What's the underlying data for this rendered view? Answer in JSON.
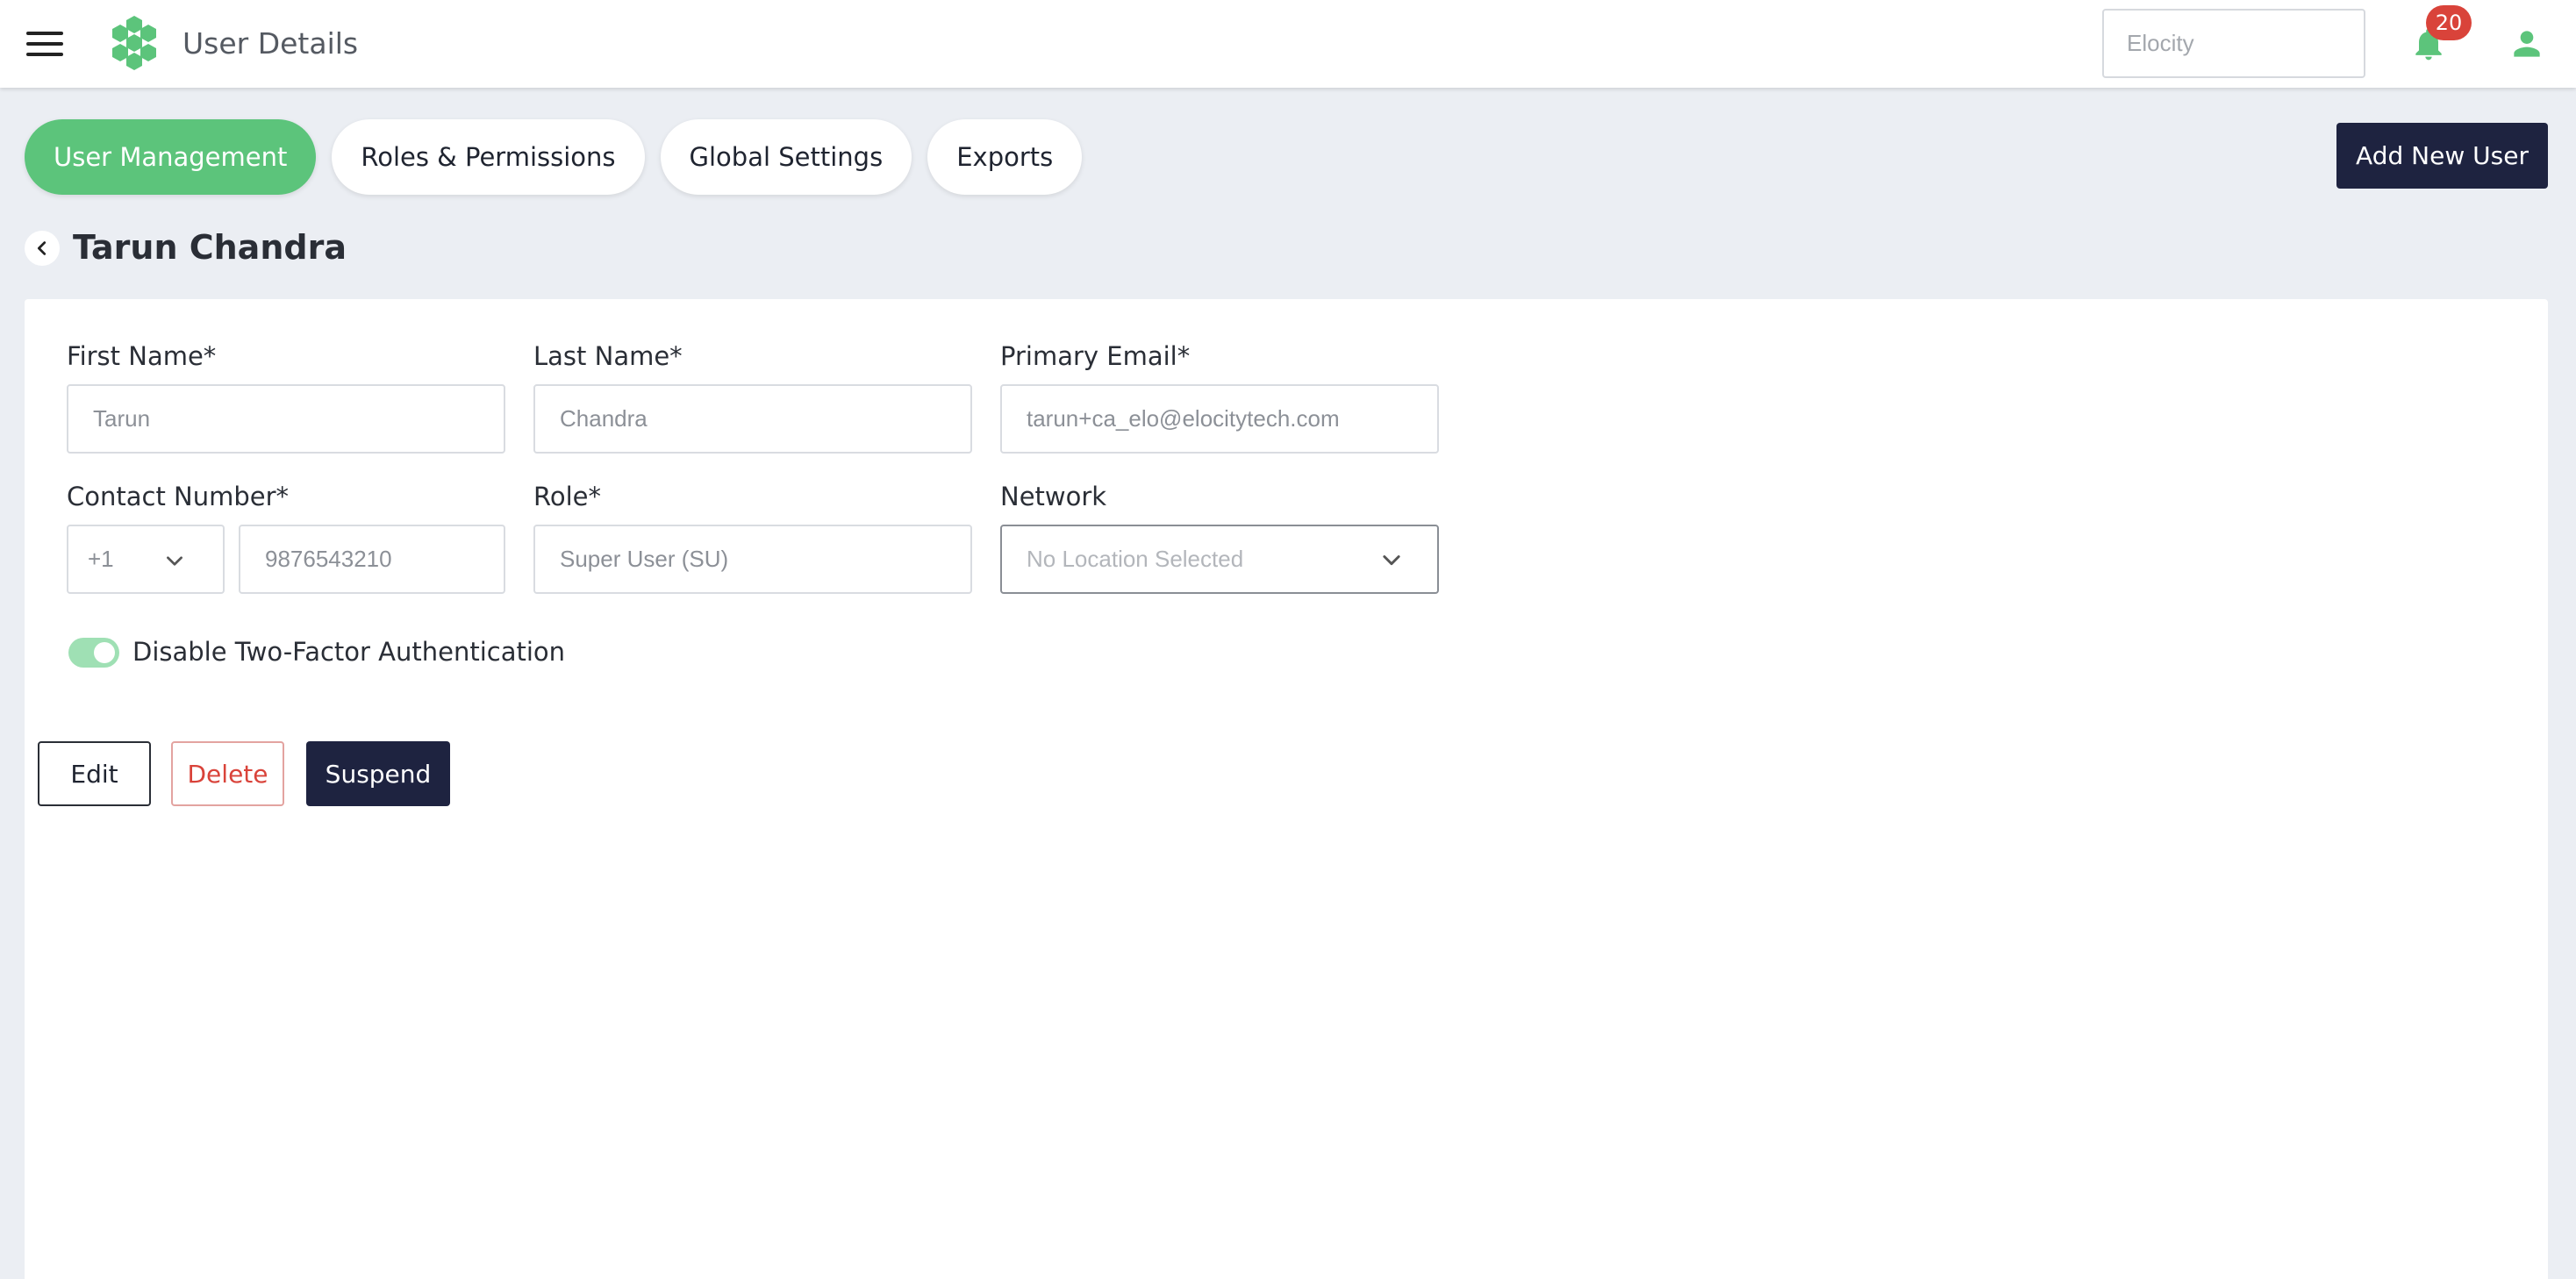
{
  "header": {
    "title": "User Details",
    "search_placeholder": "Elocity",
    "notification_count": "20"
  },
  "tabs": [
    {
      "label": "User Management",
      "active": true
    },
    {
      "label": "Roles & Permissions",
      "active": false
    },
    {
      "label": "Global Settings",
      "active": false
    },
    {
      "label": "Exports",
      "active": false
    }
  ],
  "actions": {
    "add_user_label": "Add New User"
  },
  "page": {
    "title": "Tarun Chandra"
  },
  "form": {
    "first_name": {
      "label": "First Name*",
      "value": "Tarun"
    },
    "last_name": {
      "label": "Last Name*",
      "value": "Chandra"
    },
    "primary_email": {
      "label": "Primary Email*",
      "value": "tarun+ca_elo@elocitytech.com"
    },
    "contact_number": {
      "label": "Contact Number*",
      "country_code": "+1",
      "value": "9876543210"
    },
    "role": {
      "label": "Role*",
      "value": "Super User (SU)"
    },
    "network": {
      "label": "Network",
      "value": "No Location Selected"
    },
    "two_factor": {
      "label": "Disable Two-Factor Authentication",
      "enabled": true
    }
  },
  "buttons": {
    "edit": "Edit",
    "delete": "Delete",
    "suspend": "Suspend"
  },
  "colors": {
    "accent_green": "#5cc47b",
    "dark_navy": "#1e2340",
    "danger_red": "#d9433a",
    "page_background": "#ebeef3"
  },
  "icons": {
    "menu": "hamburger-menu-icon",
    "logo": "hexagon-cluster-logo",
    "notifications": "bell-icon",
    "profile": "user-icon",
    "back": "chevron-left-icon",
    "dropdown": "chevron-down-icon"
  }
}
